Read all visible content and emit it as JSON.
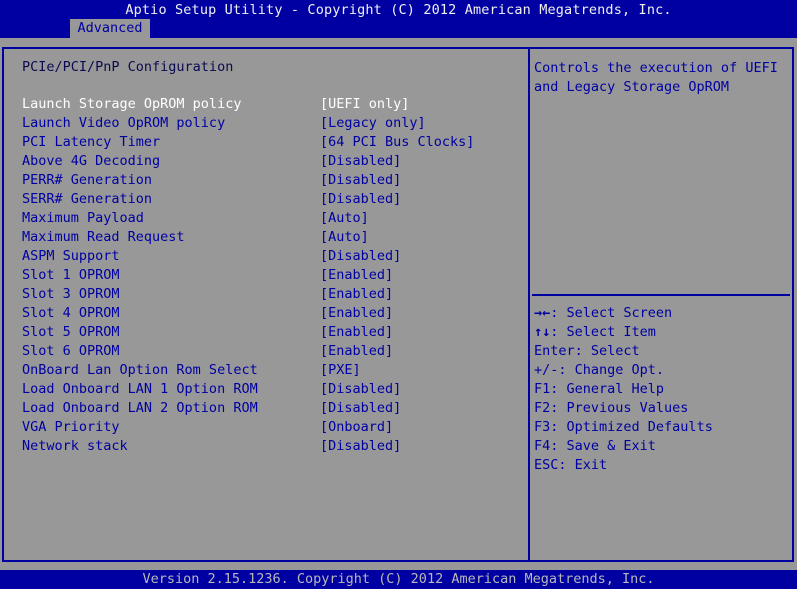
{
  "header": {
    "title": "Aptio Setup Utility - Copyright (C) 2012 American Megatrends, Inc.",
    "tabs": [
      {
        "label": "Advanced",
        "active": true
      }
    ]
  },
  "main": {
    "section_title": "PCIe/PCI/PnP Configuration",
    "settings": [
      {
        "label": "Launch Storage OpROM policy",
        "value": "[UEFI only]",
        "selected": true
      },
      {
        "label": "Launch Video OpROM policy",
        "value": "[Legacy only]"
      },
      {
        "label": "PCI Latency Timer",
        "value": "[64 PCI Bus Clocks]"
      },
      {
        "label": "Above 4G Decoding",
        "value": "[Disabled]"
      },
      {
        "label": "PERR# Generation",
        "value": "[Disabled]"
      },
      {
        "label": "SERR# Generation",
        "value": "[Disabled]"
      },
      {
        "label": "Maximum Payload",
        "value": "[Auto]"
      },
      {
        "label": "Maximum Read Request",
        "value": "[Auto]"
      },
      {
        "label": "ASPM Support",
        "value": "[Disabled]"
      },
      {
        "label": "Slot 1 OPROM",
        "value": "[Enabled]"
      },
      {
        "label": "Slot 3 OPROM",
        "value": "[Enabled]"
      },
      {
        "label": "Slot 4 OPROM",
        "value": "[Enabled]"
      },
      {
        "label": "Slot 5 OPROM",
        "value": "[Enabled]"
      },
      {
        "label": "Slot 6 OPROM",
        "value": "[Enabled]"
      },
      {
        "label": "OnBoard Lan Option Rom Select",
        "value": "[PXE]"
      },
      {
        "label": "Load Onboard LAN 1 Option ROM",
        "value": "[Disabled]"
      },
      {
        "label": "Load Onboard LAN 2 Option ROM",
        "value": "[Disabled]"
      },
      {
        "label": "VGA Priority",
        "value": "[Onboard]"
      },
      {
        "label": "Network stack",
        "value": "[Disabled]"
      }
    ]
  },
  "help": {
    "lines": [
      "Controls the execution of UEFI",
      "and Legacy Storage OpROM"
    ]
  },
  "keys": [
    {
      "key": "→←",
      "desc": ": Select Screen"
    },
    {
      "key": "↑↓",
      "desc": ": Select Item"
    },
    {
      "key": "Enter",
      "desc": ": Select"
    },
    {
      "key": "+/-",
      "desc": ": Change Opt."
    },
    {
      "key": "F1",
      "desc": ": General Help"
    },
    {
      "key": "F2",
      "desc": ": Previous Values"
    },
    {
      "key": "F3",
      "desc": ": Optimized Defaults"
    },
    {
      "key": "F4",
      "desc": ": Save & Exit"
    },
    {
      "key": "ESC",
      "desc": ": Exit"
    }
  ],
  "footer": {
    "text": "Version 2.15.1236. Copyright (C) 2012 American Megatrends, Inc."
  },
  "colors": {
    "bios_blue": "#0000a2",
    "background_gray": "#989898",
    "selected_text": "#ffffff"
  }
}
